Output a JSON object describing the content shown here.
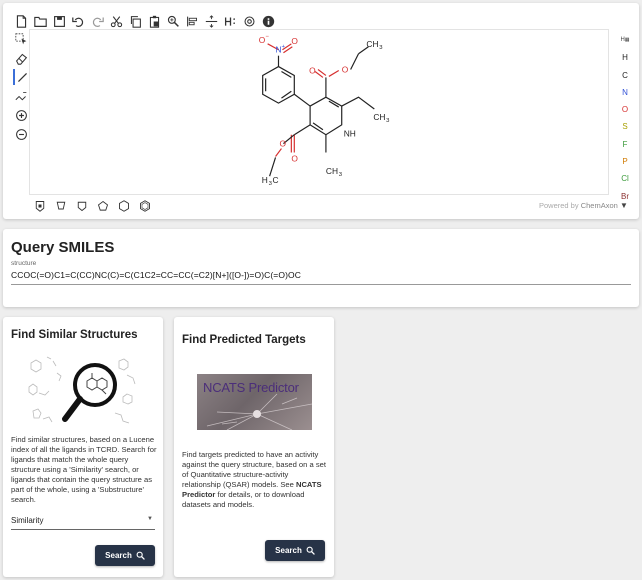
{
  "editor": {
    "atom_palette": [
      {
        "label": "H",
        "color": "#222222"
      },
      {
        "label": "C",
        "color": "#222222"
      },
      {
        "label": "N",
        "color": "#2f4fd6"
      },
      {
        "label": "O",
        "color": "#d62f2f"
      },
      {
        "label": "S",
        "color": "#a8a000"
      },
      {
        "label": "F",
        "color": "#3a9a3a"
      },
      {
        "label": "P",
        "color": "#d07a00"
      },
      {
        "label": "Cl",
        "color": "#3a9a3a"
      },
      {
        "label": "Br",
        "color": "#8b2f2f"
      }
    ],
    "periodic_label": "H",
    "powered_by": "Powered by",
    "powered_brand": "ChemAxon",
    "molecule_labels": {
      "no2_o_minus": "O",
      "no2_charge": "−",
      "no2_n": "N",
      "no2_plus": "+",
      "no2_o": "O",
      "ester_top_o1": "O",
      "ester_top_o2": "O",
      "ch3_top": "CH",
      "ch3_top_sub": "3",
      "ch3_right": "CH",
      "ch3_right_sub": "3",
      "nh": "NH",
      "ester_bottom_o1": "O",
      "ester_bottom_o2": "O",
      "h3c_h": "H",
      "h3c_sub": "3",
      "h3c_c": "C",
      "ch3_bottom": "CH",
      "ch3_bottom_sub": "3"
    }
  },
  "query": {
    "title": "Query SMILES",
    "label": "structure",
    "smiles": "CCOC(=O)C1=C(CC)NC(C)=C(C1C2=CC=CC(=C2)[N+]([O-])=O)C(=O)OC"
  },
  "similar": {
    "title": "Find Similar Structures",
    "description": "Find similar structures, based on a Lucene index of all the ligands in TCRD. Search for ligands that match the whole query structure using a 'Similarity' search, or ligands that contain the query structure as part of the whole, using a 'Substructure' search.",
    "select_value": "Similarity",
    "button_label": "Search"
  },
  "predicted": {
    "title": "Find Predicted Targets",
    "image_text": "NCATS Predictor",
    "desc_before": "Find targets predicted to have an activity against the query structure, based on a set of Quantitative structure-activity relationship (QSAR) models. See ",
    "desc_link": "NCATS Predictor",
    "desc_after": " for details, or to download datasets and models.",
    "button_label": "Search"
  },
  "colors": {
    "accent": "#273347",
    "nitrogen": "#2f4fd6",
    "oxygen": "#d62f2f",
    "active_tool": "#3b6fd8"
  }
}
